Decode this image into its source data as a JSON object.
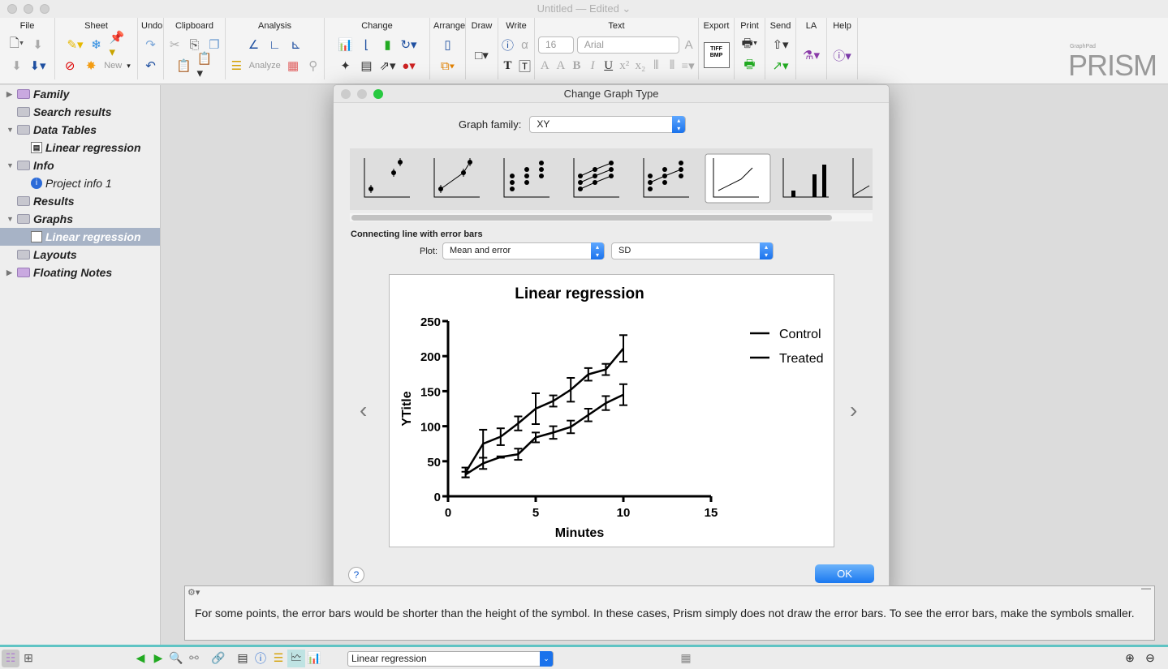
{
  "window": {
    "title": "Untitled — Edited ⌄"
  },
  "toolbar": {
    "groups": [
      "File",
      "Sheet",
      "Undo",
      "Clipboard",
      "Analysis",
      "Change",
      "Arrange",
      "Draw",
      "Write",
      "Text",
      "Export",
      "Print",
      "Send",
      "LA",
      "Help"
    ],
    "new_label": "New",
    "analyze_label": "Analyze",
    "font_size": "16",
    "font_name": "Arial",
    "export_badge": "TIFF BMP",
    "logo_small": "GraphPad",
    "logo": "PRISM"
  },
  "sidebar": {
    "items": [
      {
        "label": "Family",
        "level": 0,
        "expanded": false
      },
      {
        "label": "Search results",
        "level": 0
      },
      {
        "label": "Data Tables",
        "level": 0,
        "expanded": true
      },
      {
        "label": "Linear regression",
        "level": 1
      },
      {
        "label": "Info",
        "level": 0,
        "expanded": true
      },
      {
        "label": "Project info 1",
        "level": 1
      },
      {
        "label": "Results",
        "level": 0
      },
      {
        "label": "Graphs",
        "level": 0,
        "expanded": true
      },
      {
        "label": "Linear regression",
        "level": 1,
        "selected": true
      },
      {
        "label": "Layouts",
        "level": 0
      },
      {
        "label": "Floating Notes",
        "level": 0,
        "expanded": false
      }
    ]
  },
  "dialog": {
    "title": "Change Graph Type",
    "family_label": "Graph family:",
    "family_value": "XY",
    "graph_type": "Connecting line with error bars",
    "plot_label": "Plot:",
    "plot_value": "Mean and error",
    "error_value": "SD",
    "ok_label": "OK",
    "help": "?"
  },
  "notes": {
    "text": "For some points, the error bars would be shorter than the height of the symbol. In these cases, Prism simply does not draw the error bars. To see the error bars, make the symbols smaller."
  },
  "bottom": {
    "sheet_select": "Linear regression"
  },
  "chart_data": {
    "type": "line",
    "title": "Linear regression",
    "xlabel": "Minutes",
    "ylabel": "YTitle",
    "xlim": [
      0,
      15
    ],
    "ylim": [
      0,
      250
    ],
    "xticks": [
      0,
      5,
      10,
      15
    ],
    "yticks": [
      0,
      50,
      100,
      150,
      200,
      250
    ],
    "legend": "top-right",
    "grid": false,
    "x": [
      1,
      2,
      3,
      4,
      5,
      6,
      7,
      8,
      9,
      10
    ],
    "series": [
      {
        "name": "Control",
        "values": [
          34,
          75,
          85,
          104,
          125,
          136,
          152,
          174,
          181,
          211
        ],
        "errors": [
          7,
          20,
          12,
          10,
          22,
          8,
          17,
          9,
          8,
          19
        ]
      },
      {
        "name": "Treated",
        "values": [
          31,
          47,
          56,
          60,
          84,
          91,
          99,
          116,
          133,
          145
        ],
        "errors": [
          4,
          8,
          1,
          8,
          7,
          9,
          9,
          9,
          10,
          15
        ]
      }
    ]
  }
}
